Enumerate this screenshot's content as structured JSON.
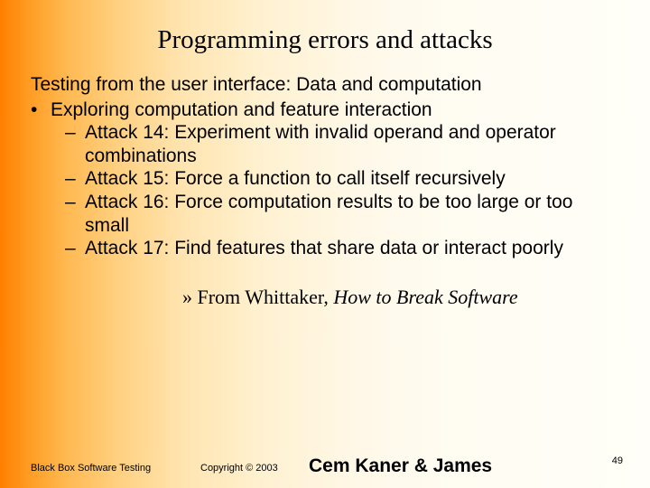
{
  "title": "Programming errors and attacks",
  "intro": "Testing from the user interface: Data and computation",
  "bullet": "Exploring computation and feature interaction",
  "attacks": [
    "Attack 14:  Experiment with invalid operand and operator combinations",
    "Attack 15:  Force a function to call itself recursively",
    "Attack 16:  Force computation results to be too large or too small",
    "Attack 17:  Find features that share data or interact poorly"
  ],
  "citation_lead": "» From Whittaker, ",
  "citation_src": "How to Break Software",
  "footer": {
    "left": "Black Box Software Testing",
    "mid": "Copyright ©  2003",
    "authors": "Cem Kaner & James",
    "page": "49"
  }
}
